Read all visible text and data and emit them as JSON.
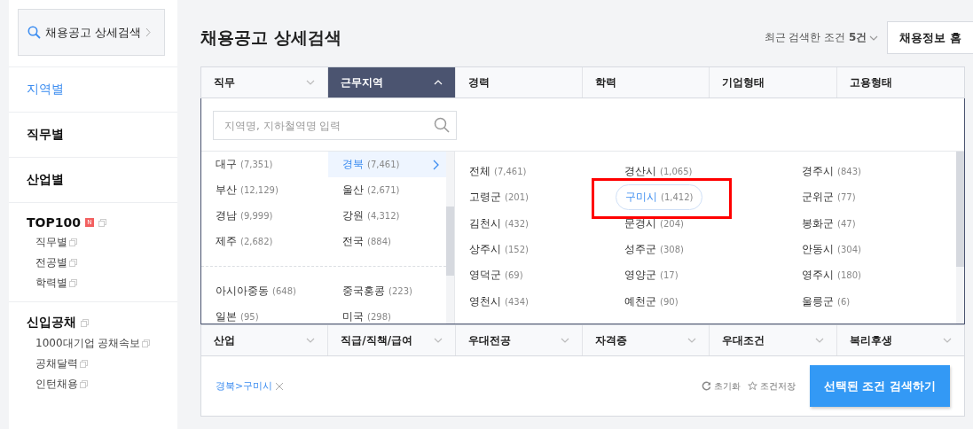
{
  "sidebar": {
    "search_button": "채용공고 상세검색",
    "menu": [
      {
        "label": "지역별",
        "selected": true
      },
      {
        "label": "직무별",
        "selected": false
      },
      {
        "label": "산업별",
        "selected": false
      }
    ],
    "sections": [
      {
        "title": "TOP100",
        "badge": "N",
        "items": [
          "직무별",
          "전공별",
          "학력별"
        ]
      },
      {
        "title": "신입공채",
        "items": [
          "1000대기업 공채속보",
          "공채달력",
          "인턴채용"
        ]
      }
    ]
  },
  "header": {
    "title": "채용공고 상세검색",
    "recent": "최근 검색한 조건 **5건**",
    "home_button": "채용정보 홈"
  },
  "filter_tabs": [
    {
      "label": "직무",
      "selected": false,
      "dropdown": true
    },
    {
      "label": "근무지역",
      "selected": true,
      "dropdown": true
    },
    {
      "label": "경력",
      "selected": false,
      "dropdown": false
    },
    {
      "label": "학력",
      "selected": false,
      "dropdown": false
    },
    {
      "label": "기업형태",
      "selected": false,
      "dropdown": false
    },
    {
      "label": "고용형태",
      "selected": false,
      "dropdown": false
    }
  ],
  "region_panel": {
    "search": {
      "placeholder": "지역명, 지하철역명 입력"
    },
    "regions": [
      {
        "name": "대구",
        "count": "(7,351)",
        "selected": false
      },
      {
        "name": "경북",
        "count": "(7,461)",
        "selected": true
      },
      {
        "name": "부산",
        "count": "(12,129)",
        "selected": false
      },
      {
        "name": "울산",
        "count": "(2,671)",
        "selected": false
      },
      {
        "name": "경남",
        "count": "(9,999)",
        "selected": false
      },
      {
        "name": "강원",
        "count": "(4,312)",
        "selected": false
      },
      {
        "name": "제주",
        "count": "(2,682)",
        "selected": false
      },
      {
        "name": "전국",
        "count": "(884)",
        "selected": false
      }
    ],
    "overseas": [
      {
        "name": "아시아중동",
        "count": "(648)",
        "selected": false
      },
      {
        "name": "중국홍콩",
        "count": "(223)",
        "selected": false
      },
      {
        "name": "일본",
        "count": "(95)",
        "selected": false
      },
      {
        "name": "미국",
        "count": "(298)",
        "selected": false
      }
    ],
    "districts": [
      {
        "name": "전체",
        "count": "(7,461)",
        "selected": false
      },
      {
        "name": "경산시",
        "count": "(1,065)",
        "selected": false
      },
      {
        "name": "경주시",
        "count": "(843)",
        "selected": false
      },
      {
        "name": "고령군",
        "count": "(201)",
        "selected": false
      },
      {
        "name": "구미시",
        "count": "(1,412)",
        "selected": true
      },
      {
        "name": "군위군",
        "count": "(77)",
        "selected": false
      },
      {
        "name": "김천시",
        "count": "(432)",
        "selected": false
      },
      {
        "name": "문경시",
        "count": "(204)",
        "selected": false
      },
      {
        "name": "봉화군",
        "count": "(47)",
        "selected": false
      },
      {
        "name": "상주시",
        "count": "(152)",
        "selected": false
      },
      {
        "name": "성주군",
        "count": "(308)",
        "selected": false
      },
      {
        "name": "안동시",
        "count": "(304)",
        "selected": false
      },
      {
        "name": "영덕군",
        "count": "(69)",
        "selected": false
      },
      {
        "name": "영양군",
        "count": "(17)",
        "selected": false
      },
      {
        "name": "영주시",
        "count": "(180)",
        "selected": false
      },
      {
        "name": "영천시",
        "count": "(434)",
        "selected": false
      },
      {
        "name": "예천군",
        "count": "(90)",
        "selected": false
      },
      {
        "name": "울릉군",
        "count": "(6)",
        "selected": false
      }
    ]
  },
  "filter_tabs_2": [
    {
      "label": "산업",
      "selected": false
    },
    {
      "label": "직급/직책/급여",
      "selected": false
    },
    {
      "label": "우대전공",
      "selected": false
    },
    {
      "label": "자격증",
      "selected": false
    },
    {
      "label": "우대조건",
      "selected": false
    },
    {
      "label": "복리후생",
      "selected": false
    }
  ],
  "selection": {
    "chips": [
      "경북>구미시"
    ],
    "reset": "초기화",
    "save": "조건저장",
    "submit": "선택된 조건 검색하기"
  }
}
